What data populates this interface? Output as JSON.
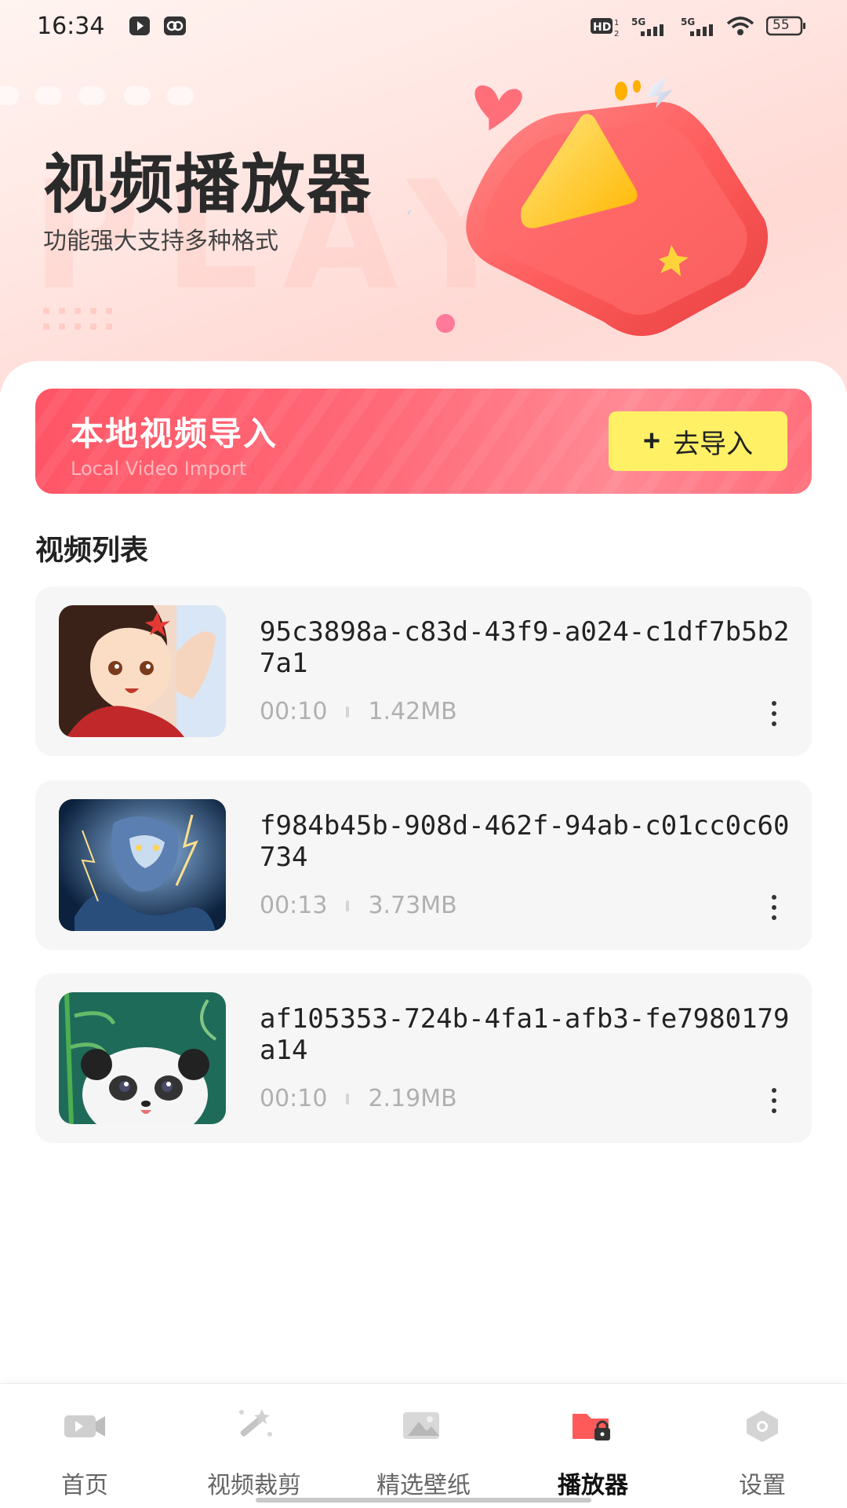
{
  "status_bar": {
    "time": "16:34",
    "battery": "55",
    "icons": [
      "play-notification-icon",
      "link-notification-icon",
      "hd-icon",
      "signal-5g-icon",
      "signal-5g-icon",
      "wifi-icon",
      "battery-icon"
    ]
  },
  "hero": {
    "title": "视频播放器",
    "subtitle": "功能强大支持多种格式",
    "watermark": "PLAY",
    "illustration": "play-cushion-icon"
  },
  "import_banner": {
    "title": "本地视频导入",
    "subtitle": "Local Video Import",
    "button_label": "去导入",
    "colors": {
      "banner": "#ff5a68",
      "button": "#fff066"
    }
  },
  "video_list": {
    "title": "视频列表",
    "items": [
      {
        "name": "95c3898a-c83d-43f9-a024-c1df7b5b27a1",
        "duration": "00:10",
        "size": "1.42MB",
        "thumb": "anime-girl-thumbnail"
      },
      {
        "name": "f984b45b-908d-462f-94ab-c01cc0c60734",
        "duration": "00:13",
        "size": "3.73MB",
        "thumb": "dragon-thumbnail"
      },
      {
        "name": "af105353-724b-4fa1-afb3-fe7980179a14",
        "duration": "00:10",
        "size": "2.19MB",
        "thumb": "panda-thumbnail"
      }
    ]
  },
  "tab_bar": {
    "tabs": [
      {
        "label": "首页",
        "icon": "video-camera-icon",
        "active": false
      },
      {
        "label": "视频裁剪",
        "icon": "magic-wand-icon",
        "active": false
      },
      {
        "label": "精选壁纸",
        "icon": "image-icon",
        "active": false
      },
      {
        "label": "播放器",
        "icon": "locked-folder-icon",
        "active": true
      },
      {
        "label": "设置",
        "icon": "settings-icon",
        "active": false
      }
    ],
    "active_color": "#ff5a5a"
  }
}
